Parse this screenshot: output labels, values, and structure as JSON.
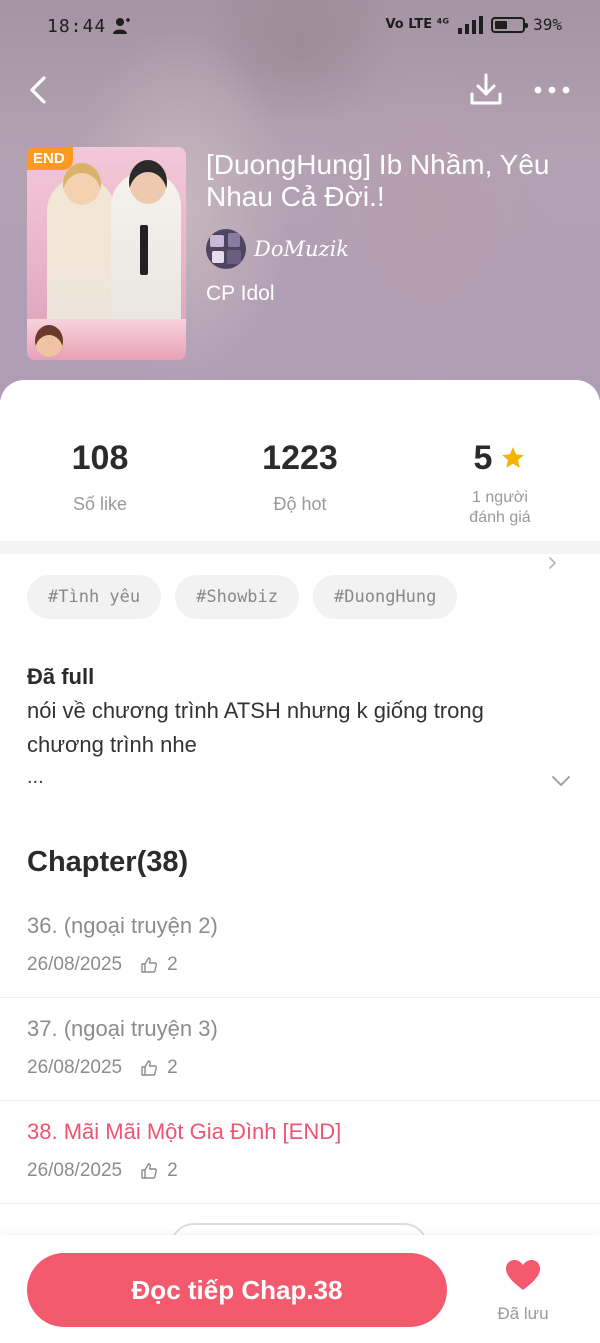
{
  "status_bar": {
    "time": "18:44",
    "network": "Vo LTE ⁴ᴳ",
    "battery": "39%"
  },
  "book": {
    "badge": "END",
    "title": "[DuongHung] Ib Nhầm, Yêu Nhau Cả Đời.!",
    "author": "DoMuzik",
    "genre": "CP Idol"
  },
  "stats": {
    "likes_value": "108",
    "likes_label": "Số like",
    "hot_value": "1223",
    "hot_label": "Độ hot",
    "rating_value": "5",
    "rating_count_line1": "1 người",
    "rating_count_line2": "đánh giá"
  },
  "tags": [
    "#Tình yêu",
    "#Showbiz",
    "#DuongHung"
  ],
  "description": {
    "status": "Đã full",
    "text": "nói về chương trình ATSH nhưng k giống trong chương trình nhe",
    "ellipsis": "..."
  },
  "chapters": {
    "heading": "Chapter(38)",
    "items": [
      {
        "title": "36. (ngoại truyện 2)",
        "date": "26/08/2025",
        "likes": "2",
        "active": false
      },
      {
        "title": "37. (ngoại truyện 3)",
        "date": "26/08/2025",
        "likes": "2",
        "active": false
      },
      {
        "title": "38. Mãi Mãi Một Gia Đình [END]",
        "date": "26/08/2025",
        "likes": "2",
        "active": true
      }
    ]
  },
  "bottom_bar": {
    "read_label": "Đọc tiếp Chap.38",
    "save_label": "Đã lưu"
  },
  "colors": {
    "accent": "#f45a6e",
    "active_chapter": "#ef5470",
    "badge": "#ff9a1f",
    "star": "#f5b400"
  },
  "icons": {
    "back": "back-arrow-icon",
    "download": "download-icon",
    "more": "more-dots-icon",
    "star": "star-icon",
    "chevron": "chevron-right-icon",
    "expand": "chevron-down-icon",
    "thumb": "thumbs-up-icon",
    "heart": "heart-icon"
  }
}
